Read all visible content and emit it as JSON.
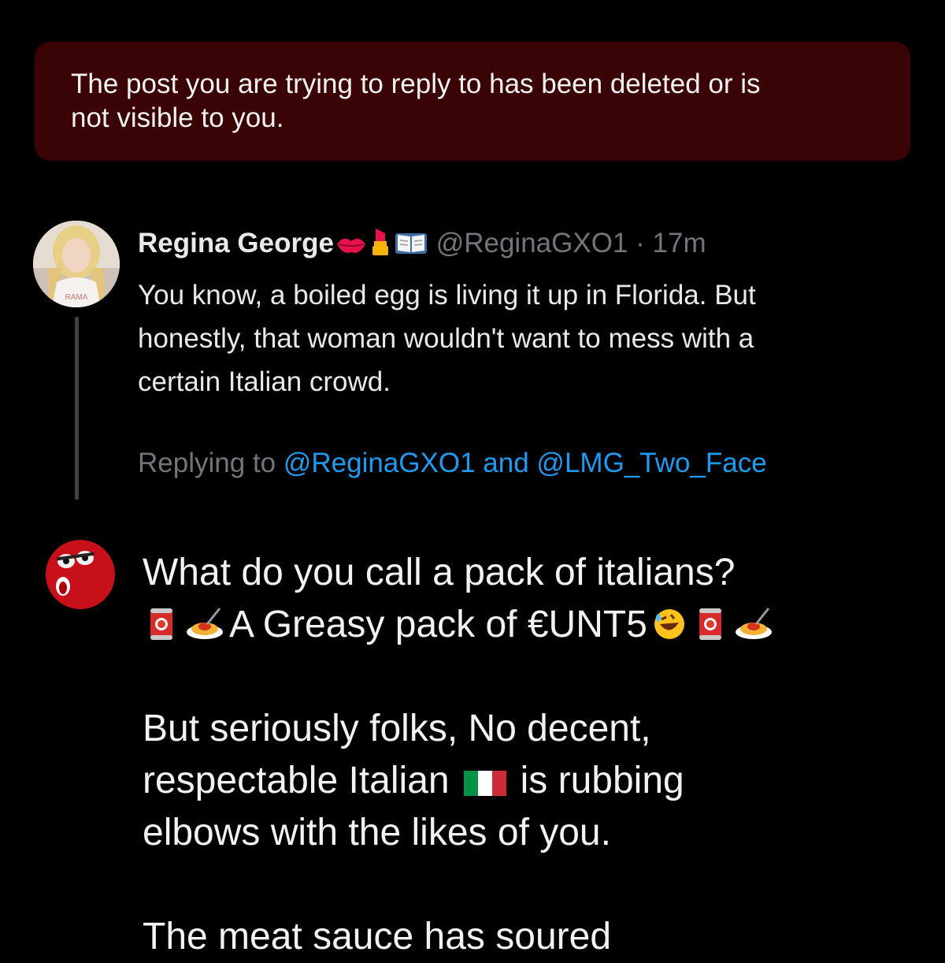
{
  "banner": {
    "message_line1": "The post you are trying to reply to has been deleted or is",
    "message_line2": "not visible to you."
  },
  "parent_post": {
    "display_name": "Regina George",
    "name_emojis": [
      "kiss-mark-icon",
      "lipstick-icon",
      "open-book-icon"
    ],
    "handle": "@ReginaGXO1",
    "separator": "·",
    "time": "17m",
    "text_lines": [
      "You know, a boiled egg is living it up in Florida. But",
      "honestly, that woman wouldn't want to mess with a",
      "certain Italian crowd."
    ],
    "replying_label": "Replying to",
    "mention_1": "@ReginaGXO1",
    "mention_joiner": "and",
    "mention_2": "@LMG_Two_Face"
  },
  "reply_draft": {
    "line1": "What do you call a pack of italians?",
    "line2_text": "A Greasy pack of €UNT5",
    "line3": "But seriously folks, No decent,",
    "line4_a": "respectable Italian",
    "line4_b": "is rubbing",
    "line5": "elbows with the likes of you.",
    "line6": "The meat sauce has soured"
  },
  "colors": {
    "background": "#000000",
    "banner_bg": "#3a0306",
    "link": "#1d9bf0",
    "muted": "#71767b"
  }
}
